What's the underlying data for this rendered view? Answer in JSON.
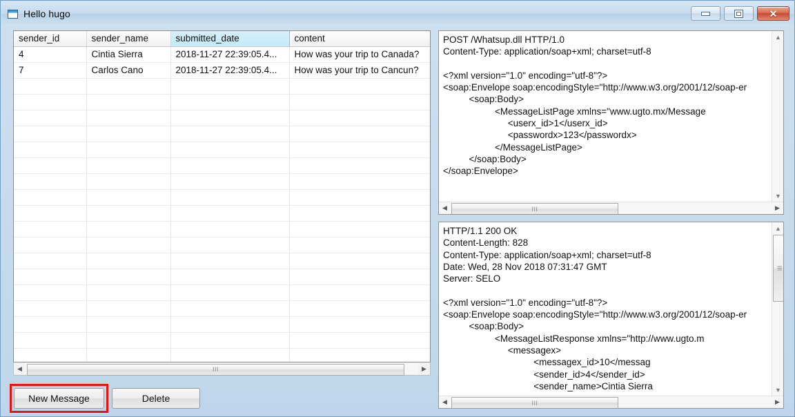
{
  "window": {
    "title": "Hello hugo",
    "icon": "app-window-icon",
    "controls": {
      "minimize": "minimize-icon",
      "maximize": "maximize-icon",
      "close": "close-icon",
      "close_glyph": "✕"
    }
  },
  "grid": {
    "columns": [
      "sender_id",
      "sender_name",
      "submitted_date",
      "content"
    ],
    "selected_column": "submitted_date",
    "rows": [
      [
        "4",
        "Cintia Sierra",
        "2018-11-27 22:39:05.4...",
        "How was your trip to Canada?"
      ],
      [
        "7",
        "Carlos Cano",
        "2018-11-27 22:39:05.4...",
        "How was your trip to Cancun?"
      ]
    ],
    "empty_row_count": 18
  },
  "scrollbars": {
    "left_arrow": "◀",
    "right_arrow": "▶",
    "up_arrow": "▲",
    "down_arrow": "▼",
    "grip": "III"
  },
  "buttons": {
    "new_message": "New Message",
    "delete": "Delete",
    "focused": "New Message",
    "focus_color": "#e8120f"
  },
  "request_panel": {
    "text": "POST /Whatsup.dll HTTP/1.0\nContent-Type: application/soap+xml; charset=utf-8\n\n<?xml version=\"1.0\" encoding=\"utf-8\"?>\n<soap:Envelope soap:encodingStyle=\"http://www.w3.org/2001/12/soap-er\n          <soap:Body>\n                    <MessageListPage xmlns=\"www.ugto.mx/Message\n                         <userx_id>1</userx_id>\n                         <passwordx>123</passwordx>\n                    </MessageListPage>\n          </soap:Body>\n</soap:Envelope>"
  },
  "response_panel": {
    "text": "HTTP/1.1 200 OK\nContent-Length: 828\nContent-Type: application/soap+xml; charset=utf-8\nDate: Wed, 28 Nov 2018 07:31:47 GMT\nServer: SELO\n\n<?xml version=\"1.0\" encoding=\"utf-8\"?>\n<soap:Envelope soap:encodingStyle=\"http://www.w3.org/2001/12/soap-er\n          <soap:Body>\n                    <MessageListResponse xmlns=\"http://www.ugto.m\n                         <messagex>\n                                   <messagex_id>10</messag\n                                   <sender_id>4</sender_id>\n                                   <sender_name>Cintia Sierra"
  },
  "colors": {
    "window_frame": "#6f9fc4",
    "titlebar": "#c6dbee",
    "selected_header": "#c5eaf9",
    "focus_red": "#e8120f"
  }
}
